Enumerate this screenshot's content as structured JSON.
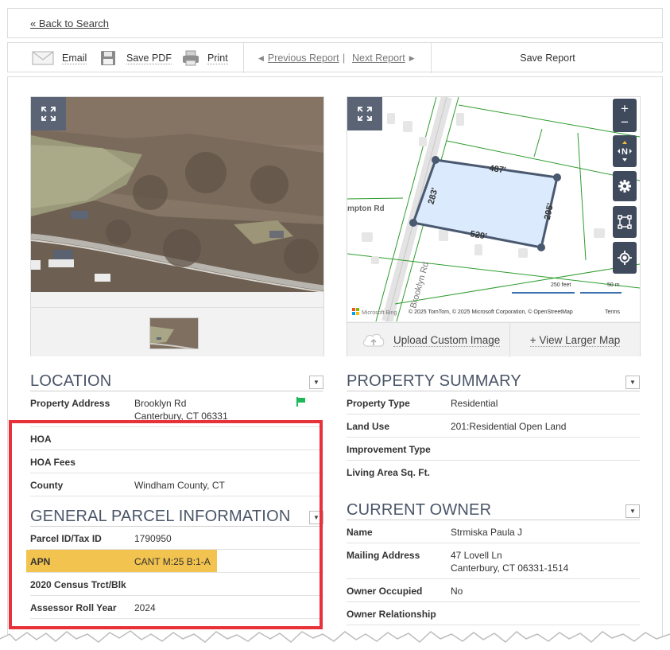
{
  "back": {
    "label": "« Back to Search"
  },
  "toolbar": {
    "email": "Email",
    "save_pdf": "Save PDF",
    "print": "Print",
    "previous": "Previous Report",
    "separator": "|",
    "next": "Next Report",
    "save_report": "Save Report"
  },
  "map": {
    "road_label": "Brooklyn Rd",
    "side_road_label": "mpton Rd",
    "dims": {
      "top": "487'",
      "right": "295'",
      "bottom": "529'",
      "left": "283'"
    },
    "scale_feet": "250 feet",
    "scale_m": "50 m",
    "provider": "Microsoft Bing",
    "attribution": "© 2025 TomTom, © 2025 Microsoft Corporation, © OpenStreetMap",
    "terms": "Terms",
    "upload_label": "Upload Custom Image",
    "larger_label": "+ View Larger Map"
  },
  "location": {
    "title": "LOCATION",
    "rows": [
      {
        "label": "Property Address",
        "value": "Brooklyn Rd",
        "value2": "Canterbury, CT 06331"
      },
      {
        "label": "HOA",
        "value": ""
      },
      {
        "label": "HOA Fees",
        "value": ""
      },
      {
        "label": "County",
        "value": "Windham County, CT"
      }
    ]
  },
  "parcel": {
    "title": "GENERAL PARCEL INFORMATION",
    "rows": [
      {
        "label": "Parcel ID/Tax ID",
        "value": "1790950"
      },
      {
        "label": "APN",
        "value": "CANT M:25 B:1-A"
      },
      {
        "label": "2020 Census Trct/Blk",
        "value": ""
      },
      {
        "label": "Assessor Roll Year",
        "value": "2024"
      }
    ]
  },
  "summary": {
    "title": "PROPERTY SUMMARY",
    "rows": [
      {
        "label": "Property Type",
        "value": "Residential"
      },
      {
        "label": "Land Use",
        "value": "201:Residential Open Land"
      },
      {
        "label": "Improvement Type",
        "value": ""
      },
      {
        "label": "Living Area Sq. Ft.",
        "value": ""
      }
    ]
  },
  "owner": {
    "title": "CURRENT OWNER",
    "rows": [
      {
        "label": "Name",
        "value": "Strmiska Paula J"
      },
      {
        "label": "Mailing Address",
        "value": "47 Lovell Ln",
        "value2": "Canterbury, CT 06331-1514"
      },
      {
        "label": "Owner Occupied",
        "value": "No"
      },
      {
        "label": "Owner Relationship",
        "value": ""
      }
    ]
  },
  "colors": {
    "section_title": "#4a5568",
    "highlight_border": "#e8323a",
    "apn_highlight": "#f2c34e",
    "map_control": "#3f4a5c",
    "parcel_fill": "#dbeafc",
    "parcel_stroke": "#4a5870",
    "parcel_lines": "#2e9c2e"
  },
  "icons": [
    "email-icon",
    "save-pdf-icon",
    "print-icon",
    "expand-icon",
    "zoom-in-icon",
    "zoom-out-icon",
    "compass-icon",
    "gear-icon",
    "draw-icon",
    "locate-icon",
    "upload-cloud-icon",
    "flag-icon",
    "dropdown-arrow-icon"
  ]
}
